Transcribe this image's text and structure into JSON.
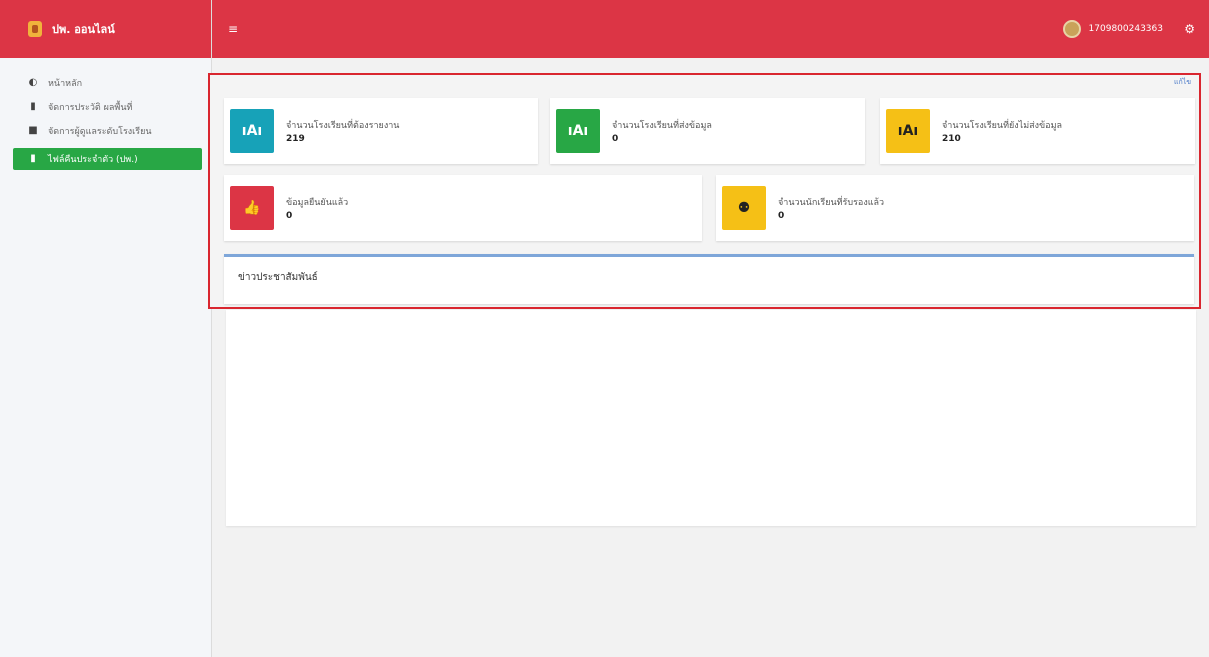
{
  "brand": {
    "title": "ปพ. ออนไลน์"
  },
  "sidebar": {
    "items": [
      {
        "label": "หน้าหลัก",
        "icon": "dashboard-icon"
      },
      {
        "label": "จัดการประวัติ ผลพื้นที่",
        "icon": "file-icon"
      },
      {
        "label": "จัดการผู้ดูแลระดับโรงเรียน",
        "icon": "book-icon"
      },
      {
        "label": "ไฟล์คืนประจำตัว (ปพ.)",
        "icon": "document-icon"
      }
    ]
  },
  "topbar": {
    "username": "1709800243363"
  },
  "content": {
    "edit_link": "แก้ไข",
    "boxes": [
      {
        "label": "จำนวนโรงเรียนที่ต้องรายงาน",
        "value": "219",
        "icon": "school-icon",
        "color": "#17a2b8"
      },
      {
        "label": "จำนวนโรงเรียนที่ส่งข้อมูล",
        "value": "0",
        "icon": "school-icon",
        "color": "#28a745"
      },
      {
        "label": "จำนวนโรงเรียนที่ยังไม่ส่งข้อมูล",
        "value": "210",
        "icon": "school-icon",
        "color": "#f5c016"
      },
      {
        "label": "ข้อมูลยืนยันแล้ว",
        "value": "0",
        "icon": "thumbs-up-icon",
        "color": "#dc3545"
      },
      {
        "label": "จำนวนนักเรียนที่รับรองแล้ว",
        "value": "0",
        "icon": "users-icon",
        "color": "#f5c016"
      }
    ],
    "news_title": "ข่าวประชาสัมพันธ์"
  }
}
